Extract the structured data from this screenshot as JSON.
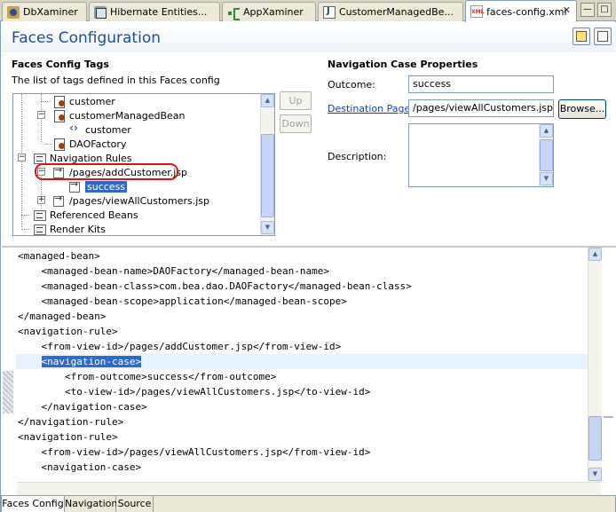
{
  "tabs": [
    {
      "label": "DbXaminer",
      "icon": "database-icon"
    },
    {
      "label": "Hibernate Entities...",
      "icon": "hibernate-icon"
    },
    {
      "label": "AppXaminer",
      "icon": "app-graph-icon"
    },
    {
      "label": "CustomerManagedBe...",
      "icon": "java-file-icon"
    },
    {
      "label": "faces-config.xml",
      "icon": "xml-file-icon",
      "active": true
    }
  ],
  "window_controls": {
    "minimize": "—",
    "maximize": "□"
  },
  "page": {
    "title": "Faces Configuration"
  },
  "tags_section": {
    "title": "Faces Config Tags",
    "description": "The list of tags defined in this Faces config",
    "tree": [
      {
        "label": "customer",
        "icon": "bean-icon"
      },
      {
        "label": "customerManagedBean",
        "icon": "bean-icon",
        "expander": "−"
      },
      {
        "label": "customer",
        "icon": "property-icon"
      },
      {
        "label": "DAOFactory",
        "icon": "bean-icon"
      },
      {
        "label": "Navigation Rules",
        "icon": "folder-icon",
        "expander": "−"
      },
      {
        "label": "/pages/addCustomer.jsp",
        "icon": "navigation-rule-icon",
        "expander": "−",
        "circled": true
      },
      {
        "label": "success",
        "icon": "navigation-case-icon",
        "selected": true
      },
      {
        "label": "/pages/viewAllCustomers.jsp",
        "icon": "navigation-rule-icon",
        "expander": "+"
      },
      {
        "label": "Referenced Beans",
        "icon": "folder-icon"
      },
      {
        "label": "Render Kits",
        "icon": "folder-icon"
      }
    ],
    "buttons": {
      "up": "Up",
      "down": "Down"
    }
  },
  "properties_section": {
    "title": "Navigation Case Properties",
    "outcome_label": "Outcome:",
    "outcome_value": "success",
    "destination_label": "Destination Page:",
    "destination_value": "/pages/viewAllCustomers.jsp",
    "browse_label": "Browse...",
    "description_label": "Description:",
    "description_value": ""
  },
  "source": {
    "lines": [
      "<managed-bean>",
      "    <managed-bean-name>DAOFactory</managed-bean-name>",
      "    <managed-bean-class>com.bea.dao.DAOFactory</managed-bean-class>",
      "    <managed-bean-scope>application</managed-bean-scope>",
      "</managed-bean>",
      "<navigation-rule>",
      "    <from-view-id>/pages/addCustomer.jsp</from-view-id>",
      "    <navigation-case>",
      "        <from-outcome>success</from-outcome>",
      "        <to-view-id>/pages/viewAllCustomers.jsp</to-view-id>",
      "    </navigation-case>",
      "</navigation-rule>",
      "<navigation-rule>",
      "    <from-view-id>/pages/viewAllCustomers.jsp</from-view-id>",
      "    <navigation-case>"
    ],
    "selected_line_index": 7
  },
  "bottom_tabs": [
    {
      "label": "Faces Config",
      "active": true
    },
    {
      "label": "Navigation"
    },
    {
      "label": "Source"
    }
  ]
}
